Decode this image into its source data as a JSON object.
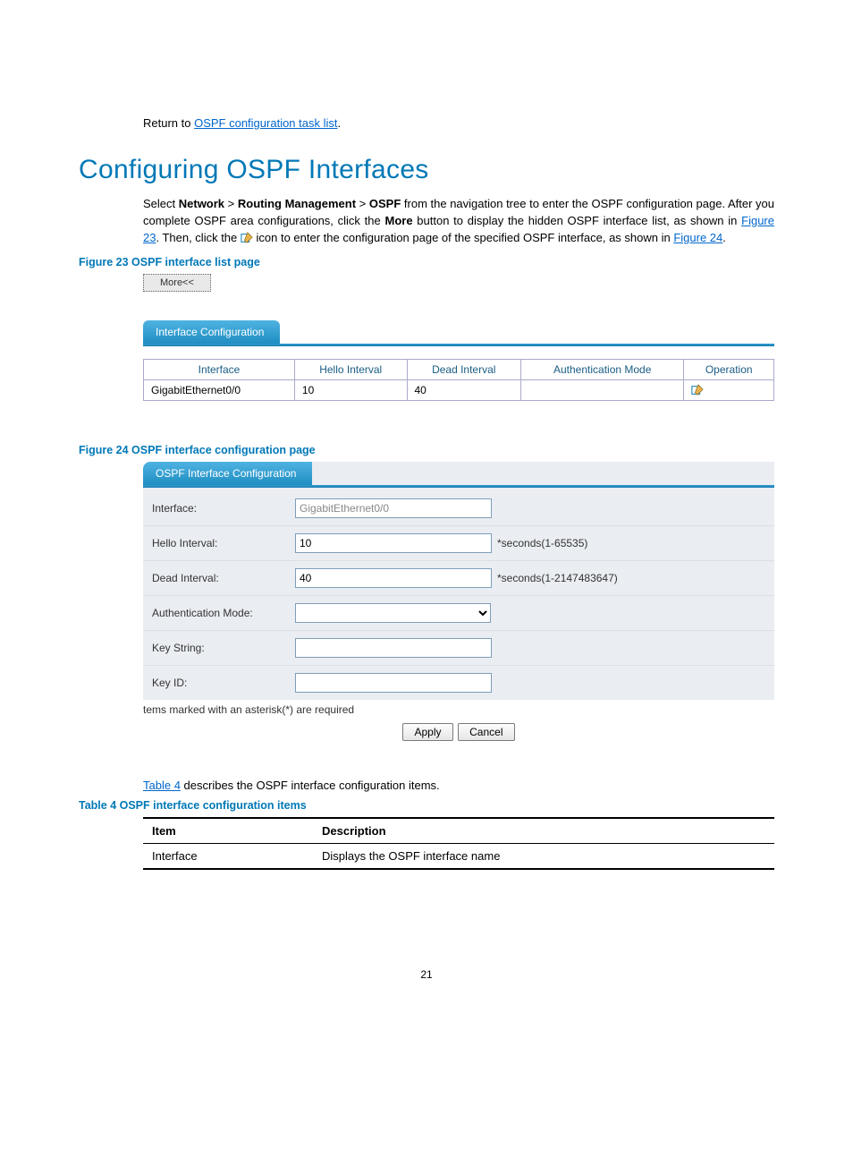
{
  "return_line": {
    "prefix": "Return to ",
    "link": "OSPF configuration task list",
    "suffix": "."
  },
  "heading": "Configuring OSPF Interfaces",
  "para1": {
    "t1": "Select ",
    "b1": "Network",
    "t2": " > ",
    "b2": "Routing Management",
    "t3": " > ",
    "b3": "OSPF",
    "t4": " from the navigation tree to enter the OSPF configuration page. After you complete OSPF area configurations, click the ",
    "b4": "More",
    "t5": " button to display the hidden OSPF interface list, as shown in ",
    "link1": "Figure 23",
    "t6": ". Then, click the ",
    "t7": " icon to enter the configuration page of the specified OSPF interface, as shown in ",
    "link2": "Figure 24",
    "t8": "."
  },
  "fig23_caption": "Figure 23 OSPF interface list page",
  "more_btn": "More<<",
  "tab_iface_config": "Interface Configuration",
  "iface_table": {
    "headers": [
      "Interface",
      "Hello Interval",
      "Dead Interval",
      "Authentication Mode",
      "Operation"
    ],
    "row": [
      "GigabitEthernet0/0",
      "10",
      "40",
      "",
      ""
    ]
  },
  "fig24_caption": "Figure 24 OSPF interface configuration page",
  "tab_ospf_config": "OSPF Interface Configuration",
  "form": {
    "interface_lbl": "Interface:",
    "interface_val": "GigabitEthernet0/0",
    "hello_lbl": "Hello Interval:",
    "hello_val": "10",
    "hello_suf": "*seconds(1-65535)",
    "dead_lbl": "Dead Interval:",
    "dead_val": "40",
    "dead_suf": "*seconds(1-2147483647)",
    "auth_lbl": "Authentication Mode:",
    "keystr_lbl": "Key String:",
    "keyid_lbl": "Key ID:",
    "footnote": "tems marked with an asterisk(*) are required",
    "apply": "Apply",
    "cancel": "Cancel"
  },
  "after_fig": {
    "link": "Table 4",
    "rest": " describes the OSPF interface configuration items."
  },
  "table4_caption": "Table 4 OSPF interface configuration items",
  "desc_table": {
    "h1": "Item",
    "h2": "Description",
    "r1c1": "Interface",
    "r1c2": "Displays the OSPF interface name"
  },
  "pagenum": "21"
}
